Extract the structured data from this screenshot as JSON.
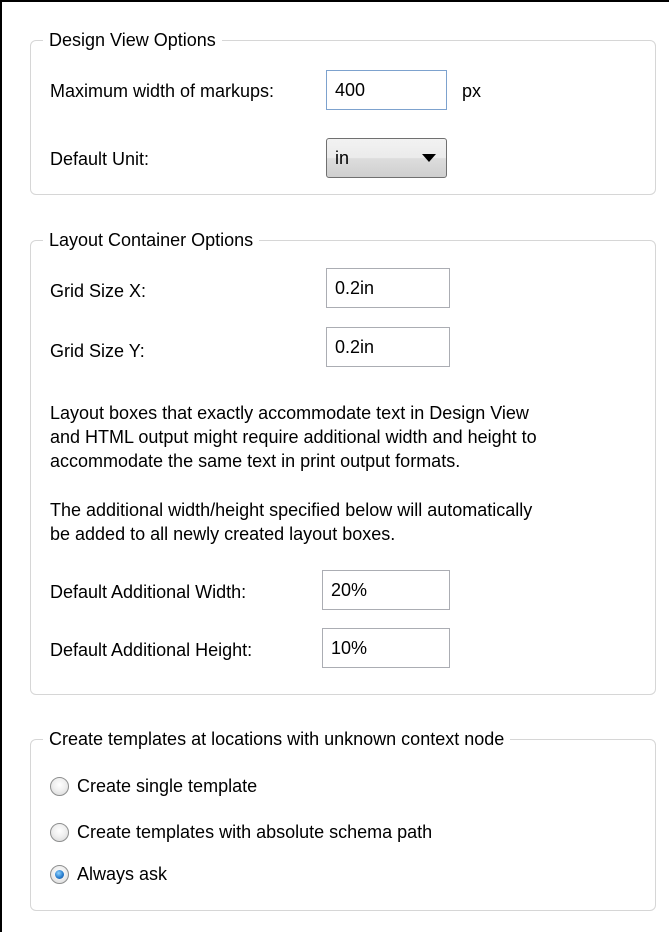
{
  "design_view": {
    "title": "Design View Options",
    "max_width_label": "Maximum width of markups:",
    "max_width_value": "400",
    "max_width_unit": "px",
    "default_unit_label": "Default Unit:",
    "default_unit_value": "in"
  },
  "layout_container": {
    "title": "Layout Container Options",
    "grid_x_label": "Grid Size X:",
    "grid_x_value": "0.2in",
    "grid_y_label": "Grid Size Y:",
    "grid_y_value": "0.2in",
    "info_line1": "Layout boxes that exactly accommodate text in Design View",
    "info_line2": "and HTML output might require additional width and height to",
    "info_line3": "accommodate the same text in print output formats.",
    "info2_line1": "The additional width/height specified below will automatically",
    "info2_line2": "be added to all newly created layout boxes.",
    "add_width_label": "Default Additional Width:",
    "add_width_value": "20%",
    "add_height_label": "Default Additional Height:",
    "add_height_value": "10%"
  },
  "templates": {
    "title": "Create templates at locations with unknown context node",
    "options": [
      {
        "label": "Create single template",
        "checked": false
      },
      {
        "label": "Create templates with absolute schema path",
        "checked": false
      },
      {
        "label": "Always ask",
        "checked": true
      }
    ]
  }
}
